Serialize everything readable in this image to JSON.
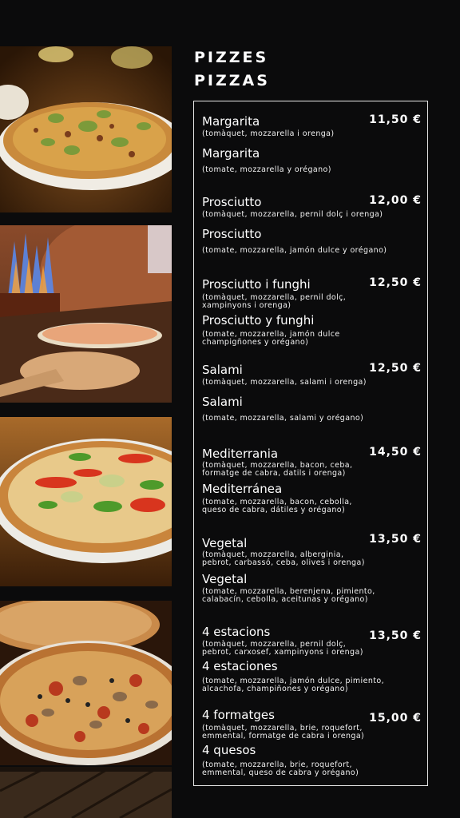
{
  "header": {
    "title_ca": "PIZZES",
    "title_es": "PIZZAS"
  },
  "menu": [
    {
      "ca_name": "Margarita",
      "ca_desc": [
        "(tomàquet, mozzarella i orenga)"
      ],
      "es_name": "Margarita",
      "es_desc": [
        "(tomate, mozzarella y orégano)"
      ],
      "price": "11,50 €"
    },
    {
      "ca_name": "Prosciutto",
      "ca_desc": [
        "(tomàquet, mozzarella, pernil dolç i orenga)"
      ],
      "es_name": "Prosciutto",
      "es_desc": [
        "(tomate, mozzarella, jamón dulce y orégano)"
      ],
      "price": "12,00 €"
    },
    {
      "ca_name": "Prosciutto i funghi",
      "ca_desc": [
        "(tomàquet, mozzarella, pernil dolç,",
        "xampinyons i orenga)"
      ],
      "es_name": "Prosciutto y funghi",
      "es_desc": [
        "(tomate, mozzarella, jamón dulce",
        "champigñones y orégano)"
      ],
      "price": "12,50 €"
    },
    {
      "ca_name": "Salami",
      "ca_desc": [
        "(tomàquet, mozzarella, salami i orenga)"
      ],
      "es_name": "Salami",
      "es_desc": [
        "(tomate, mozzarella, salami y orégano)"
      ],
      "price": "12,50 €"
    },
    {
      "ca_name": "Mediterrania",
      "ca_desc": [
        "(tomàquet, mozzarella, bacon, ceba,",
        "formatge de cabra, datils i orenga)"
      ],
      "es_name": "Mediterránea",
      "es_desc": [
        "(tomate, mozzarella, bacon, cebolla,",
        "queso de cabra, dátiles y orégano)"
      ],
      "price": "14,50 €"
    },
    {
      "ca_name": "Vegetal",
      "ca_desc": [
        "(tomàquet, mozzarella, alberginia,",
        "pebrot, carbassó, ceba, olives i orenga)"
      ],
      "es_name": "Vegetal",
      "es_desc": [
        "(tomate, mozzarella, berenjena, pimiento,",
        "calabacín, cebolla, aceitunas y orégano)"
      ],
      "price": "13,50 €"
    },
    {
      "ca_name": "4 estacions",
      "ca_desc": [
        "(tomàquet, mozzarella, pernil dolç,",
        "pebrot, carxosef, xampinyons i orenga)"
      ],
      "es_name": "4 estaciones",
      "es_desc": [
        " (tomate, mozzarella, jamón dulce, pimiento,",
        " alcachofa, champiñones y orégano)"
      ],
      "price": "13,50 €"
    },
    {
      "ca_name": "4 formatges",
      "ca_desc": [
        "(tomàquet, mozzarella, brie, roquefort,",
        "emmental, formatge de cabra i orenga)"
      ],
      "es_name": "4 quesos",
      "es_desc": [
        " (tomate, mozzarella, brie, roquefort,",
        " emmental, queso de cabra y orégano)"
      ],
      "price": "15,00 €"
    }
  ]
}
